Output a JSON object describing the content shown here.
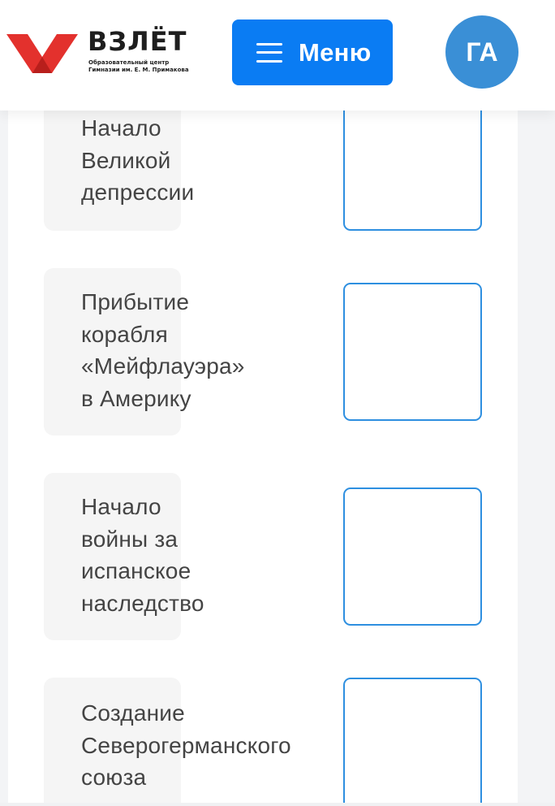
{
  "header": {
    "logo": {
      "title": "ВЗЛЁТ",
      "subtitle_line1": "Образовательный центр",
      "subtitle_line2": "Гимназии им. Е. М. Примакова",
      "mark_color": "#e3312d"
    },
    "menu_button": {
      "label": "Меню",
      "icon": "hamburger-icon",
      "color": "#0a7cf3"
    },
    "avatar": {
      "initials": "ГА",
      "color": "#3a8fd6"
    }
  },
  "events": [
    {
      "lines": [
        "Начало",
        "Великой",
        "депрессии"
      ]
    },
    {
      "lines": [
        "Прибытие",
        "корабля",
        "«Мейфлауэра»",
        "в Америку"
      ]
    },
    {
      "lines": [
        "Начало",
        "войны за",
        "испанское",
        "наследство"
      ]
    },
    {
      "lines": [
        "Создание",
        "Северогерманского",
        "союза"
      ]
    }
  ],
  "colors": {
    "drop_box_border": "#2e8fe0",
    "card_background": "#f5f5f5",
    "text": "#444444"
  }
}
